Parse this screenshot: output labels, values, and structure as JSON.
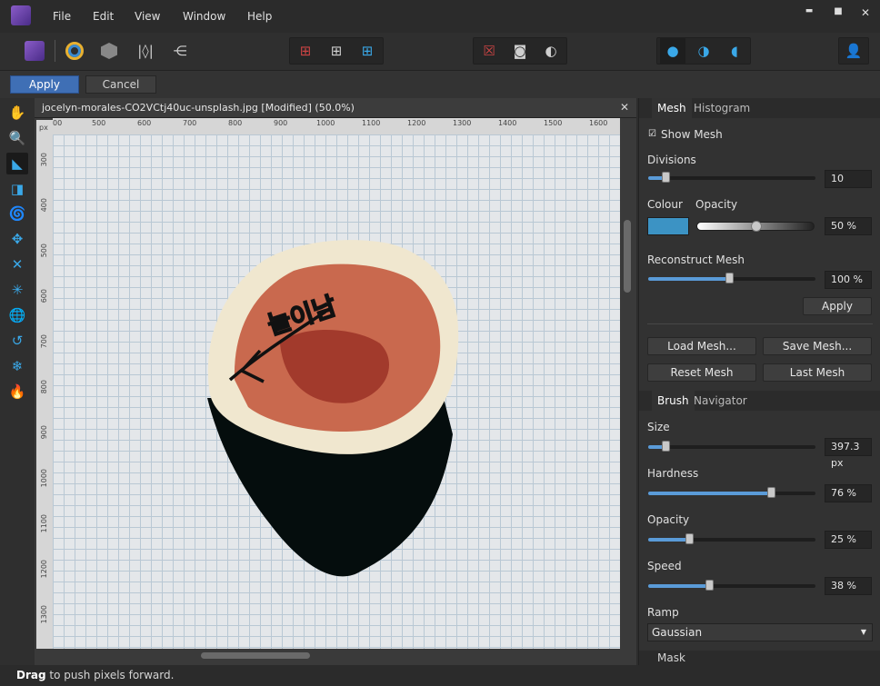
{
  "menu": {
    "file": "File",
    "edit": "Edit",
    "view": "View",
    "window": "Window",
    "help": "Help"
  },
  "window_buttons": {
    "minimize": "▬",
    "maximize": "■",
    "close": "✕"
  },
  "context_bar": {
    "apply": "Apply",
    "cancel": "Cancel"
  },
  "document": {
    "tab_title": "jocelyn-morales-CO2VCtj40uc-unsplash.jpg [Modified] (50.0%)",
    "close": "✕",
    "ruler_unit": "px",
    "h_ruler": [
      "00",
      "500",
      "600",
      "700",
      "800",
      "900",
      "1000",
      "1100",
      "1200",
      "1300",
      "1400",
      "1500",
      "1600"
    ],
    "v_ruler": [
      "300",
      "400",
      "500",
      "600",
      "700",
      "800",
      "900",
      "1000",
      "1100",
      "1200",
      "1300"
    ],
    "annotation": "늘이남"
  },
  "mesh_panel": {
    "tab_mesh": "Mesh",
    "tab_histogram": "Histogram",
    "show_mesh": "Show Mesh",
    "show_mesh_checked": true,
    "divisions_label": "Divisions",
    "divisions_value": "10",
    "divisions_fraction": 0.11,
    "colour_label": "Colour",
    "colour_value": "#3c93c4",
    "opacity_label": "Opacity",
    "opacity_value": "50 %",
    "opacity_fraction": 0.5,
    "reconstruct_label": "Reconstruct Mesh",
    "reconstruct_value": "100 %",
    "reconstruct_fraction": 0.49,
    "apply": "Apply",
    "load_mesh": "Load Mesh...",
    "save_mesh": "Save Mesh...",
    "reset_mesh": "Reset Mesh",
    "last_mesh": "Last Mesh"
  },
  "brush_panel": {
    "tab_brush": "Brush",
    "tab_navigator": "Navigator",
    "size_label": "Size",
    "size_value": "397.3 px",
    "size_fraction": 0.11,
    "hardness_label": "Hardness",
    "hardness_value": "76 %",
    "hardness_fraction": 0.74,
    "opacity_label": "Opacity",
    "opacity_value": "25 %",
    "opacity_fraction": 0.25,
    "speed_label": "Speed",
    "speed_value": "38 %",
    "speed_fraction": 0.37,
    "ramp_label": "Ramp",
    "ramp_value": "Gaussian",
    "mask_tab": "Mask"
  },
  "status": {
    "bold": "Drag",
    "rest": " to push pixels forward."
  },
  "colors": {
    "accent": "#3aa8e8",
    "apply_button": "#3f6fb5"
  }
}
